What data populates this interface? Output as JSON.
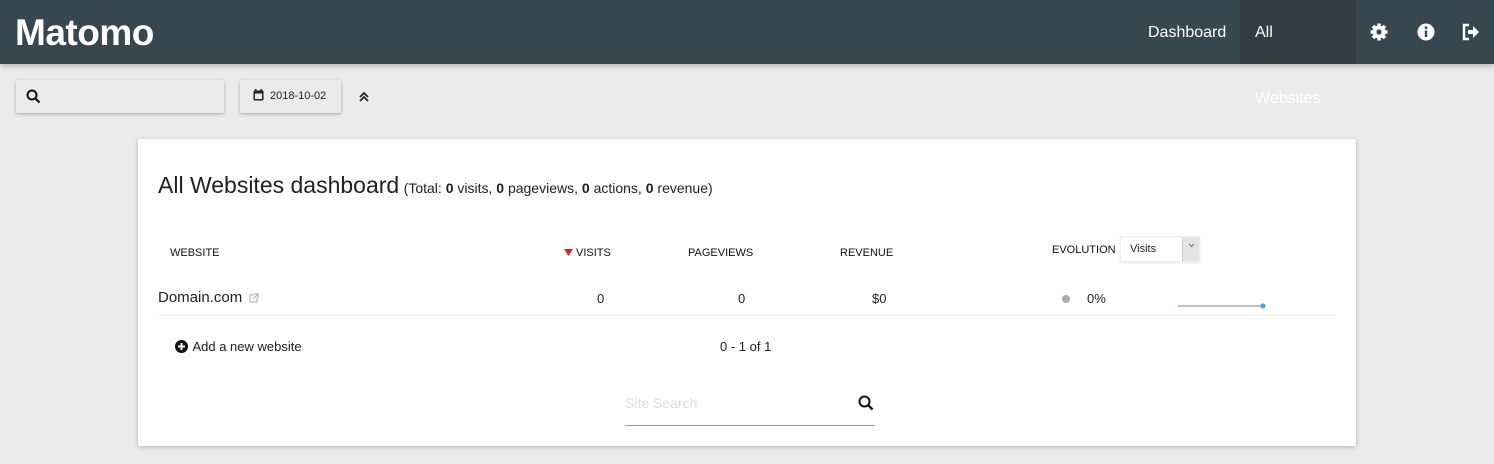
{
  "nav": {
    "logo": "Matomo",
    "links": [
      {
        "label": "Dashboard"
      },
      {
        "label": "All Websites"
      }
    ],
    "icons": [
      "gear-icon",
      "info-icon",
      "sign-out-icon"
    ]
  },
  "toolbar": {
    "search_value": "",
    "date": "2018-10-02"
  },
  "dashboard": {
    "title": "All Websites dashboard",
    "total_prefix": "(Total: ",
    "visits": "0",
    "visits_label": " visits, ",
    "pageviews": "0",
    "pageviews_label": " pageviews, ",
    "actions": "0",
    "actions_label": " actions, ",
    "revenue": "0",
    "revenue_label": " revenue)"
  },
  "table": {
    "headers": {
      "website": "Website",
      "visits": "Visits",
      "pageviews": "Pageviews",
      "revenue": "Revenue",
      "evolution": "Evolution"
    },
    "evolution_select": "Visits",
    "rows": [
      {
        "website": "Domain.com",
        "visits": "0",
        "pageviews": "0",
        "revenue": "$0",
        "evolution": "0%"
      }
    ]
  },
  "footer": {
    "add_website": "Add a new website",
    "pagination": "0 - 1 of 1",
    "site_search_placeholder": "Site Search"
  },
  "colors": {
    "nav": "#37474f",
    "sort_arrow": "#d4291f",
    "sparkline": "#4a9cf5"
  }
}
